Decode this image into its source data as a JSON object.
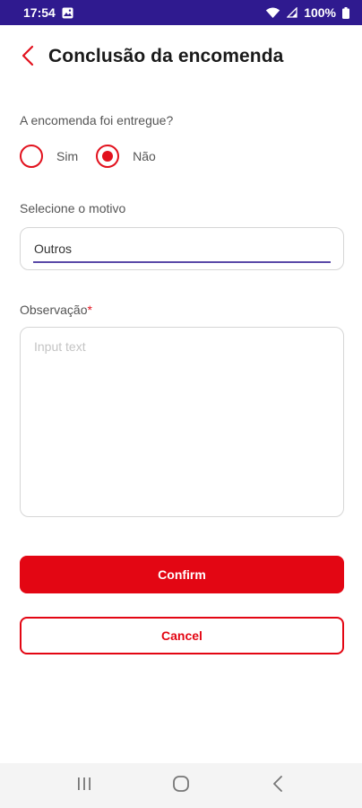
{
  "status_bar": {
    "time": "17:54",
    "battery": "100%",
    "icons": [
      "image-icon",
      "wifi-icon",
      "signal-icon",
      "battery-icon"
    ],
    "background": "#2f1a8f"
  },
  "header": {
    "title": "Conclusão da encomenda",
    "back_icon": "chevron-left-icon"
  },
  "delivery": {
    "question": "A encomenda foi entregue?",
    "options": [
      {
        "label": "Sim",
        "selected": false
      },
      {
        "label": "Não",
        "selected": true
      }
    ]
  },
  "reason": {
    "label": "Selecione o motivo",
    "value": "Outros"
  },
  "observation": {
    "label": "Observação",
    "required_mark": "*",
    "placeholder": "Input text",
    "value": ""
  },
  "actions": {
    "confirm_label": "Confirm",
    "cancel_label": "Cancel"
  },
  "colors": {
    "accent": "#e30613",
    "underline": "#5a4aa8"
  },
  "nav_bar": {
    "icons": [
      "recent-apps-icon",
      "home-icon",
      "back-icon"
    ]
  }
}
